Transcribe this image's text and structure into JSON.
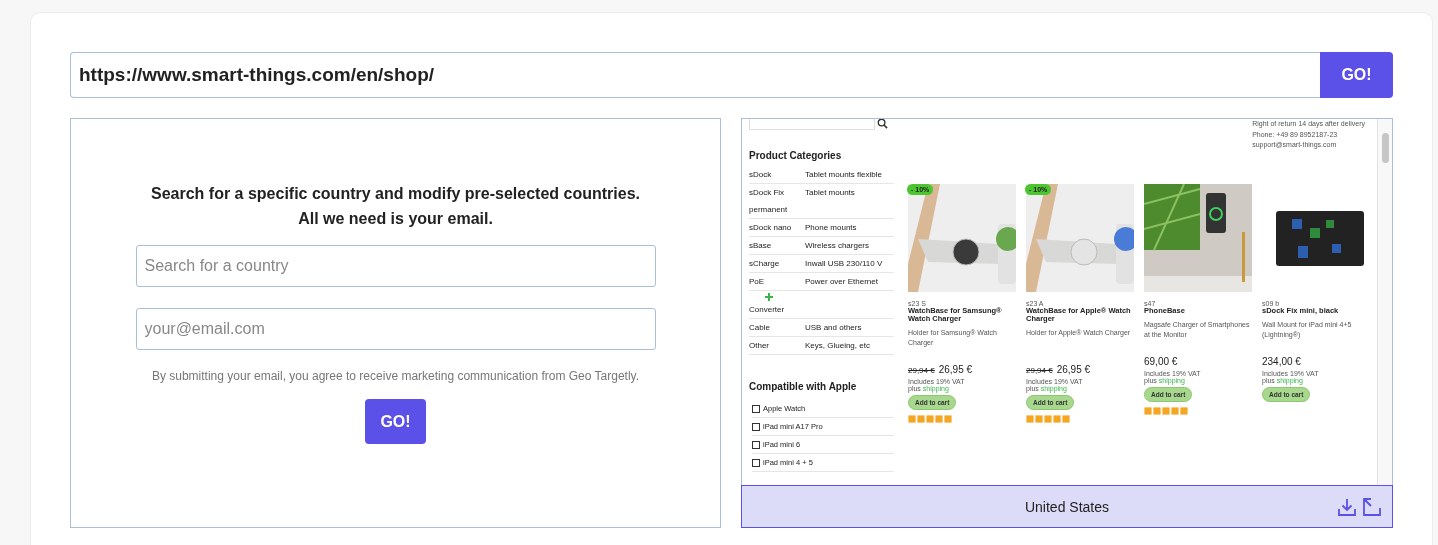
{
  "url_bar": {
    "value": "https://www.smart-things.com/en/shop/",
    "button": "GO!"
  },
  "form": {
    "heading_lines": [
      "Search for a specific country and modify pre-selected countries.",
      "All we need is your email."
    ],
    "country_field": {
      "placeholder": "Search for a country"
    },
    "email_field": {
      "placeholder": "your@email.com"
    },
    "disclaimer": "By submitting your email, you agree to receive marketing communication from Geo Targetly.",
    "button": "GO!"
  },
  "preview": {
    "shop_info": [
      "Right of return 14 days after delivery",
      "Phone: +49 89 8952187-23",
      "support@smart-things.com"
    ],
    "categories_title": "Product Categories",
    "categories": [
      {
        "name": "sDock",
        "desc": "Tablet mounts flexible",
        "plus_icon": false
      },
      {
        "name": "sDock Fix permanent",
        "desc": "Tablet mounts",
        "plus_icon": false
      },
      {
        "name": "sDock nano",
        "desc": "Phone mounts",
        "plus_icon": false
      },
      {
        "name": "sBase",
        "desc": "Wireless chargers",
        "plus_icon": false
      },
      {
        "name": "sCharge",
        "desc": "Inwall USB 230/110 V",
        "plus_icon": false
      },
      {
        "name": "PoE",
        "desc": "Power over Ethernet",
        "plus_icon": false
      },
      {
        "name": "Converter",
        "plus_icon": true
      },
      {
        "name": "Cable",
        "desc": "USB and others",
        "plus_icon": false
      },
      {
        "name": "Other",
        "desc": "Keys, Glueing, etc",
        "plus_icon": false
      }
    ],
    "compat_title": "Compatible with Apple",
    "compat": [
      {
        "label": "Apple Watch",
        "checked": false
      },
      {
        "label": "iPad mini A17 Pro",
        "checked": false
      },
      {
        "label": "iPad mini 6",
        "checked": false
      },
      {
        "label": "iPad mini 4 + 5",
        "checked": false
      }
    ],
    "products": [
      {
        "badge": "- 10%",
        "sku": "s23 S",
        "name": "WatchBase for Samsung® Watch Charger",
        "desc": "Holder for Samsung® Watch Charger",
        "old_price": "29,94 €",
        "price": "26,95 €",
        "vat": "Includes 19% VAT",
        "ship_prefix": "plus",
        "ship_link": "shipping",
        "button": "Add to cart",
        "stars": 5
      },
      {
        "badge": "- 10%",
        "sku": "s23 A",
        "name": "WatchBase for Apple® Watch Charger",
        "desc": "Holder for Apple® Watch Charger",
        "old_price": "29,94 €",
        "price": "26,95 €",
        "vat": "Includes 19% VAT",
        "ship_prefix": "plus",
        "ship_link": "shipping",
        "button": "Add to cart",
        "stars": 5
      },
      {
        "sku": "s47",
        "name": "PhoneBase",
        "desc": "Magsafe Charger of Smartphones at the Monitor",
        "price": "69,00 €",
        "vat": "Includes 19% VAT",
        "ship_prefix": "plus",
        "ship_link": "shipping",
        "button": "Add to cart",
        "stars": 5
      },
      {
        "sku": "s09 b",
        "name": "sDock Fix mini, black",
        "desc": "Wall Mount for iPad mini 4+5 (Lightning®)",
        "price": "234,00 €",
        "vat": "Includes 19% VAT",
        "ship_prefix": "plus",
        "ship_link": "shipping",
        "button": "Add to cart"
      }
    ],
    "country": "United States"
  }
}
